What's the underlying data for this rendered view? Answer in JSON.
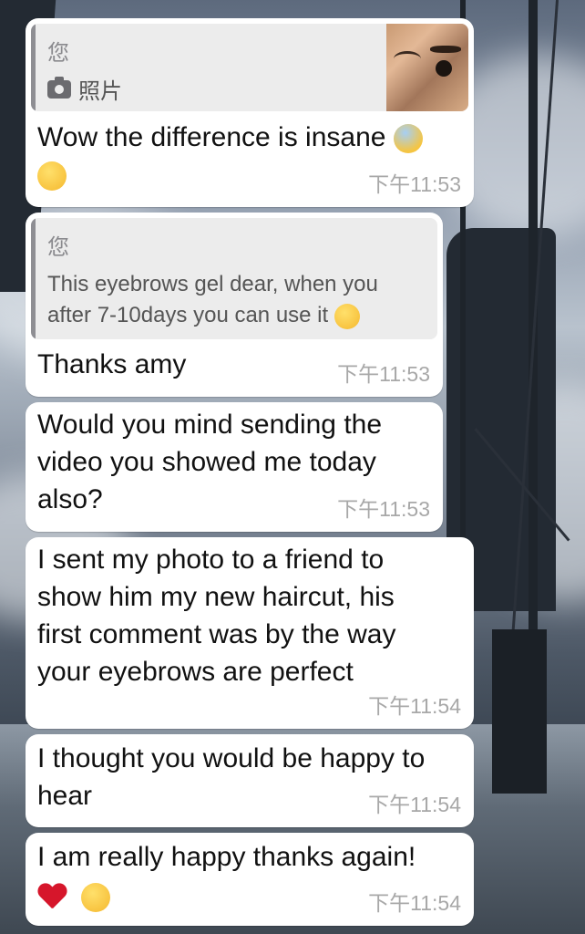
{
  "messages": [
    {
      "quote_author": "您",
      "quote_photo_label": "照片",
      "text": "Wow the difference is insane",
      "time": "下午11:53",
      "emojis": [
        "face-screaming-in-fear-emoji",
        "heart-eyes-emoji"
      ]
    },
    {
      "quote_author": "您",
      "quote_line1": "This eyebrows gel dear, when you",
      "quote_line2": "after 7-10days you can use it",
      "quote_emoji": "hugging-face-emoji",
      "text": "Thanks amy",
      "time": "下午11:53"
    },
    {
      "line1": "Would you mind sending the",
      "line2": "video you showed me today",
      "line3": "also?",
      "time": "下午11:53"
    },
    {
      "line1": "I sent my photo to a friend to",
      "line2": "show him my new haircut, his",
      "line3": "first comment was by the way",
      "line4": "your eyebrows are perfect",
      "time": "下午11:54"
    },
    {
      "line1": "I thought you would be happy to",
      "line2": "hear",
      "time": "下午11:54"
    },
    {
      "line1": "I am really happy thanks again!",
      "emojis": [
        "red-heart-emoji",
        "face-blowing-kiss-emoji"
      ],
      "time": "下午11:54"
    }
  ],
  "colors": {
    "bubble": "#ffffff",
    "quote_bg": "#ececec",
    "quote_bar": "#8e8e93",
    "timestamp": "#a8a8a8"
  }
}
